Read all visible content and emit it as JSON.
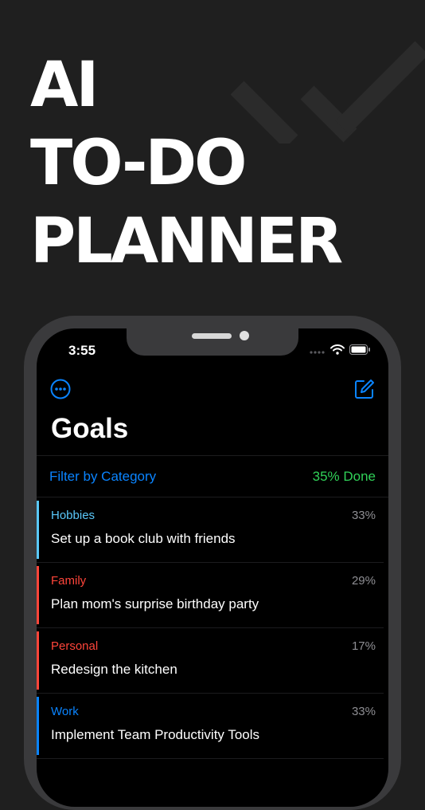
{
  "hero": {
    "line1": "AI",
    "line2": "TO-DO",
    "line3": "PLANNER"
  },
  "status_bar": {
    "time": "3:55",
    "icons": [
      "signal-icon",
      "wifi-icon",
      "battery-icon"
    ]
  },
  "nav": {
    "left_icon": "more-circle-icon",
    "right_icon": "compose-icon",
    "accent": "#0a84ff"
  },
  "page": {
    "title": "Goals"
  },
  "filter": {
    "label": "Filter by Category",
    "done": "35% Done",
    "done_color": "#30d158"
  },
  "goals": [
    {
      "category": "Hobbies",
      "percent": "33%",
      "title": "Set up a book club with friends",
      "color": "#5ac8fa"
    },
    {
      "category": "Family",
      "percent": "29%",
      "title": "Plan mom's surprise birthday party",
      "color": "#ff453a"
    },
    {
      "category": "Personal",
      "percent": "17%",
      "title": "Redesign the kitchen",
      "color": "#ff453a"
    },
    {
      "category": "Work",
      "percent": "33%",
      "title": "Implement Team Productivity Tools",
      "color": "#0a84ff"
    }
  ]
}
